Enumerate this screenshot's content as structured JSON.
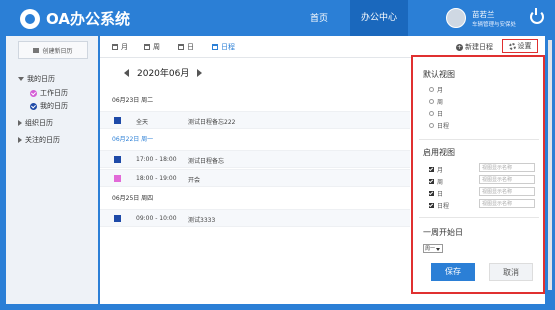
{
  "app": {
    "title": "OA办公系统"
  },
  "nav": {
    "home": "首页",
    "office": "办公中心"
  },
  "user": {
    "name": "苗若兰",
    "dept": "车辆管理与安保处"
  },
  "sidebar": {
    "new_calendar": "创建新日历",
    "my_calendar": "我的日历",
    "sub_items": [
      {
        "label": "工作日历",
        "color": "#d45ed6"
      },
      {
        "label": "我的日历",
        "color": "#1e4aa8"
      }
    ],
    "org_calendar": "组织日历",
    "followed_calendar": "关注的日历"
  },
  "toolbar": {
    "tabs": [
      "月",
      "周",
      "日",
      "日程"
    ],
    "active_tab": "日程",
    "new_schedule": "新建日程",
    "settings": "设置"
  },
  "calendar": {
    "month_label": "2020年06月",
    "days": [
      {
        "date": "06月23日 周二",
        "events": [
          {
            "time": "全天",
            "title": "测试日程备忘222",
            "color": "#1e4aa8"
          }
        ]
      },
      {
        "date": "06月22日 周一",
        "events": [
          {
            "time": "17:00 - 18:00",
            "title": "测试日程备忘",
            "color": "#1e4aa8"
          },
          {
            "time": "18:00 - 19:00",
            "title": "开会",
            "color": "#e26ad8"
          }
        ]
      },
      {
        "date": "06月25日 周四",
        "events": [
          {
            "time": "09:00 - 10:00",
            "title": "测试3333",
            "color": "#1e4aa8"
          }
        ]
      }
    ]
  },
  "settings_panel": {
    "default_view_title": "默认视图",
    "default_view_options": [
      "月",
      "周",
      "日",
      "日程"
    ],
    "enabled_view_title": "启用视图",
    "enabled_views": [
      "月",
      "周",
      "日",
      "日程"
    ],
    "alias_placeholder": "视图显示名称",
    "week_start_title": "一周开始日",
    "week_start_value": "周一",
    "save": "保存",
    "cancel": "取消"
  }
}
